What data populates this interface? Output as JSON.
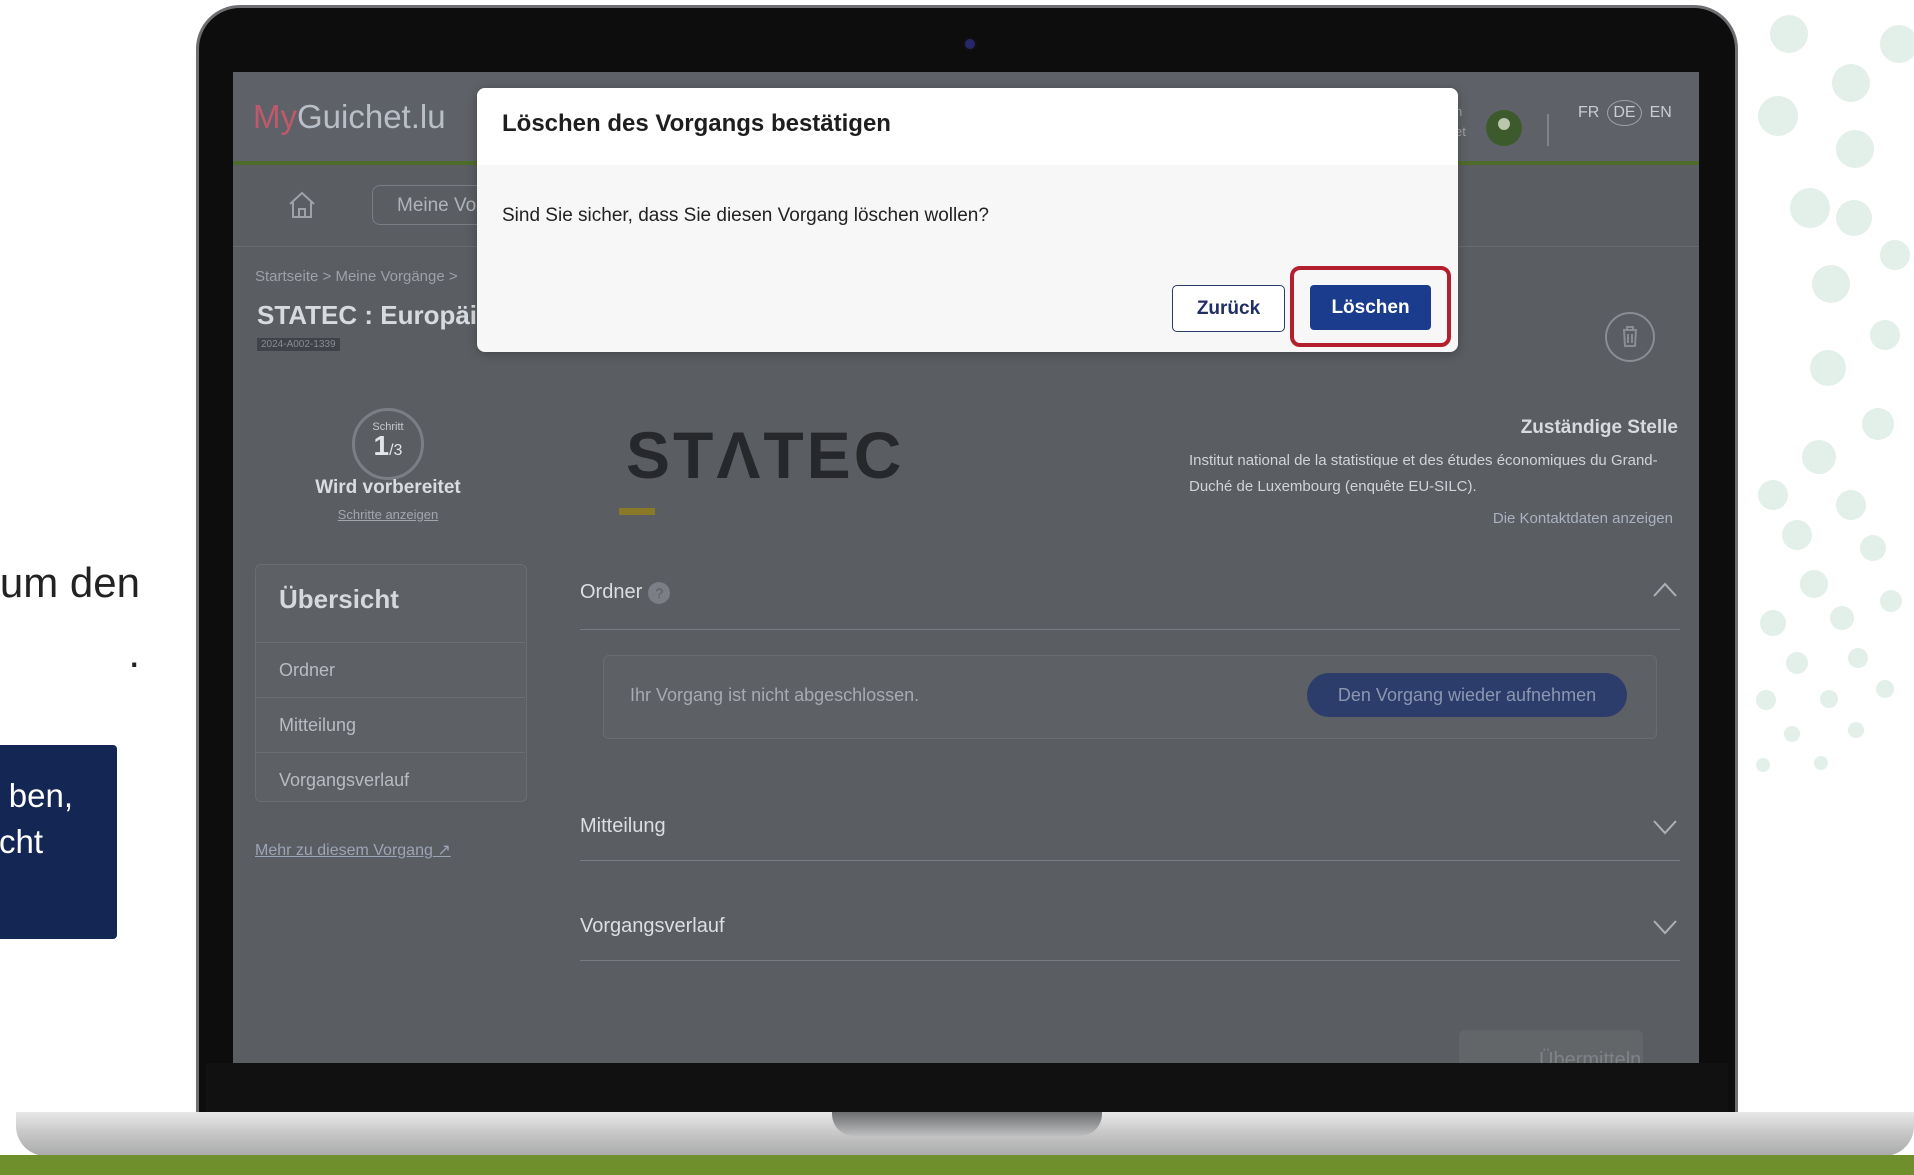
{
  "slide": {
    "side_text_line1": "um den",
    "side_text_line2": ".",
    "callout_line1": "ben,",
    "callout_line2": "cht"
  },
  "app": {
    "logo_prefix": "My",
    "logo_rest": "Guichet.lu",
    "header_partial_text1": "h",
    "header_partial_text2": "et",
    "languages": [
      "FR",
      "DE",
      "EN"
    ],
    "nav_button": "Meine Vorgänge",
    "breadcrumb": "Startseite  >  Meine Vorgänge  >",
    "page_title": "STATEC : Europäische",
    "reference": "2024-A002-1339",
    "step_label": "Schritt",
    "step_current": "1",
    "step_total": "/3",
    "status": "Wird vorbereitet",
    "show_steps": "Schritte anzeigen",
    "overview_title": "Übersicht",
    "overview_items": [
      "Ordner",
      "Mitteilung",
      "Vorgangsverlauf"
    ],
    "more_link": "Mehr zu diesem Vorgang",
    "org_logo_text": "STΛTEC",
    "authority_heading": "Zuständige Stelle",
    "authority_name": "Institut national de la statistique et des études économiques du Grand-Duché de Luxembourg (enquête EU-SILC).",
    "contact_link": "Die Kontaktdaten anzeigen",
    "sections": {
      "ordner": "Ordner",
      "mitteilung": "Mitteilung",
      "verlauf": "Vorgangsverlauf"
    },
    "card_text": "Ihr Vorgang ist nicht abgeschlossen.",
    "resume_button": "Den Vorgang wieder aufnehmen",
    "submit_button": "Übermitteln"
  },
  "modal": {
    "title": "Löschen des Vorgangs bestätigen",
    "body": "Sind Sie sicher, dass Sie diesen Vorgang löschen wollen?",
    "back_button": "Zurück",
    "delete_button": "Löschen"
  },
  "colors": {
    "primary": "#1b3b8c",
    "highlight": "#b41f2d",
    "callout": "#142654"
  }
}
